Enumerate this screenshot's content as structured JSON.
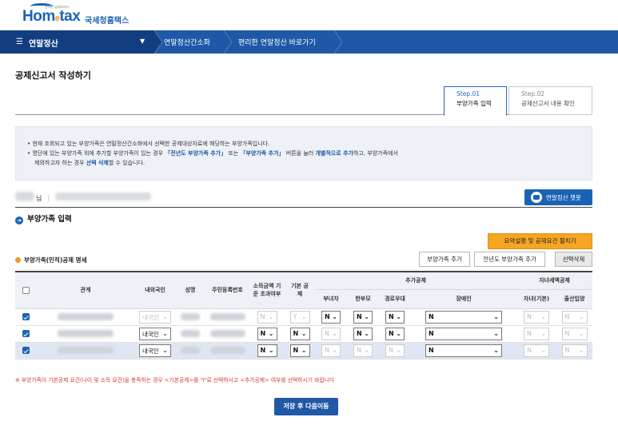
{
  "header": {
    "logo_small": "전자민 납세서비스",
    "logo_main": "Hom",
    "logo_e": "e",
    "logo_tax": "tax",
    "logo_kr": "국세청홈택스"
  },
  "nav": {
    "menu_label": "연말정산",
    "items": [
      "연말정산간소화",
      "편리한 연말정산 바로가기"
    ]
  },
  "page_title": "공제신고서 작성하기",
  "steps": [
    {
      "num": "Step.01",
      "label": "부양가족 입력"
    },
    {
      "num": "Step.02",
      "label": "공제신고서 내용 확인"
    }
  ],
  "info": {
    "line1": "현재 조회되고 있는 부양가족은 연말정산간소화에서 선택한 공제대상자료에 해당하는 부양가족입니다.",
    "line2_a": "명단에 있는 부양가족 외에 추가할 부양가족이 있는 경우 ",
    "line2_b": "「전년도 부양가족 추가」",
    "line2_c": " 또는 ",
    "line2_d": "「부양가족 추가」",
    "line2_e": " 버튼을 눌러 ",
    "line2_f": "개별적으로 추가",
    "line2_g": "하고, 부양가족에서",
    "line3_a": "제외하고자 하는 경우 ",
    "line3_b": "선택 삭제",
    "line3_c": "할 수 있습니다."
  },
  "user": {
    "suffix": "님",
    "sep": "|",
    "chatbot_label": "연말정산 챗봇"
  },
  "section_title": "부양가족 입력",
  "summary_button": "요약설명 및 공제요건 펼치기",
  "table_title": "부양가족(인적)공제 명세",
  "buttons": {
    "add": "부양가족 추가",
    "add_prev": "전년도 부양가족 추가",
    "delete": "선택삭제"
  },
  "table": {
    "headers": {
      "relation": "관계",
      "nationality": "내외국인",
      "name": "성명",
      "id": "주민등록번호",
      "income": "소득금액 기준 초과여부",
      "basic": "기본 공제",
      "extra": "추가공제",
      "child": "자녀세액공제",
      "single_woman": "부녀자",
      "single_parent": "한부모",
      "elderly": "경로우대",
      "disabled": "장애인",
      "child_basic": "자녀(기본)",
      "adoption": "출산입양"
    },
    "rows": [
      {
        "checked": true,
        "nationality": "내국인",
        "income": "N",
        "basic": "Y",
        "woman": "N",
        "parent": "N",
        "elderly": "N",
        "disabled": "N",
        "child": "N",
        "adoption": "N"
      },
      {
        "checked": true,
        "nationality": "내국인",
        "income": "N",
        "basic": "N",
        "woman": "N",
        "parent": "N",
        "elderly": "N",
        "disabled": "N",
        "child": "N",
        "adoption": "N"
      },
      {
        "checked": true,
        "nationality": "내국인",
        "income": "N",
        "basic": "N",
        "woman": "N",
        "parent": "N",
        "elderly": "N",
        "disabled": "N",
        "child": "N",
        "adoption": "N"
      }
    ]
  },
  "note": "※ 부양가족이 기본공제 요건(나이 및 소득 요건)을 충족하는 경우 <기본공제>를 'Y'로 선택하시고 <추가공제> 여부를 선택하시기 바랍니다",
  "save_button": "저장 후 다음이동",
  "colors": {
    "brand": "#1f58a6",
    "orange": "#f6a623",
    "note_red": "#d43a2c"
  }
}
